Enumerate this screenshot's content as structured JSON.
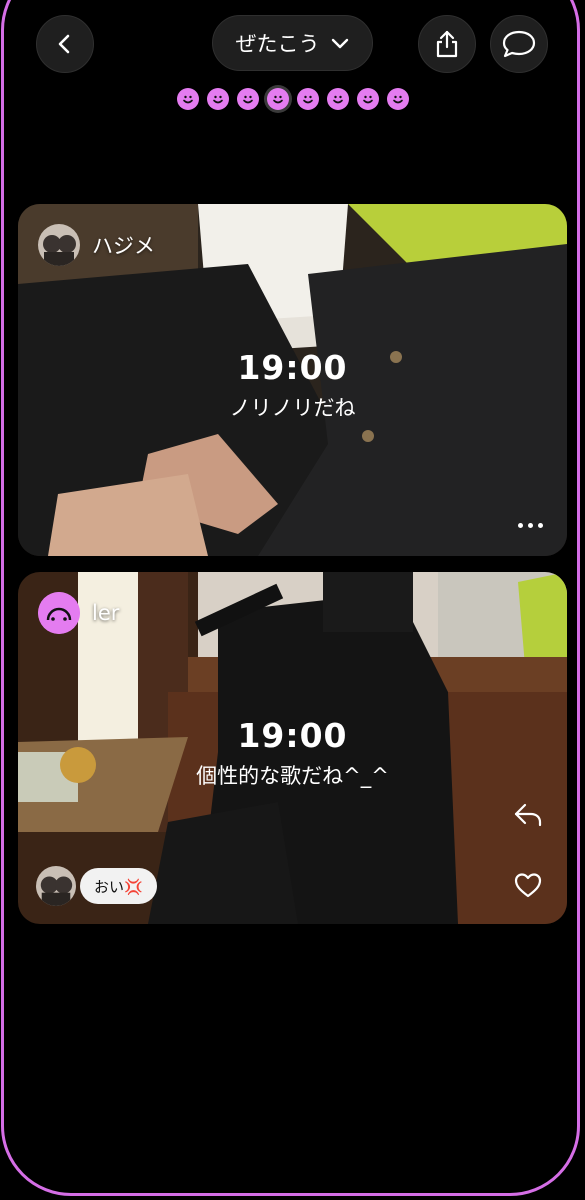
{
  "header": {
    "title": "ぜたこう",
    "back_icon": "chevron-left-icon",
    "share_icon": "share-icon",
    "chat_icon": "chat-bubble-icon"
  },
  "pager": {
    "count": 8,
    "active_index": 3,
    "accent": "#e47cf0"
  },
  "posts": [
    {
      "user": "ハジメ",
      "time": "19:00",
      "caption": "ノリノリだね",
      "more_icon": "more-dots-icon"
    },
    {
      "user": "ler",
      "time": "19:00",
      "caption": "個性的な歌だね^_^",
      "reaction": "おい💢",
      "reply_icon": "reply-icon",
      "like_icon": "heart-icon"
    }
  ],
  "colors": {
    "frame": "#d56ee6",
    "background": "#000000"
  }
}
